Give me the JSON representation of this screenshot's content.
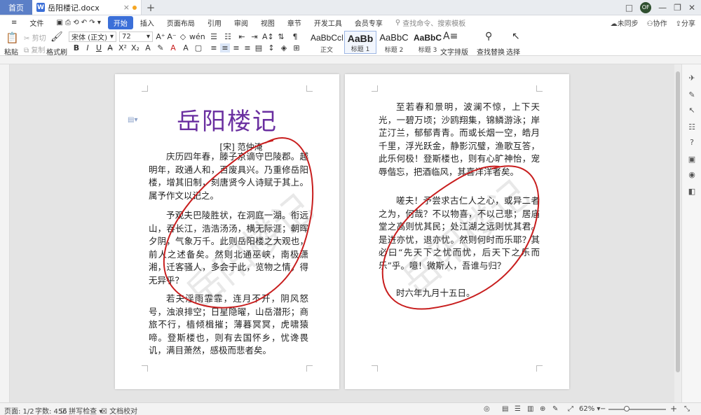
{
  "titlebar": {
    "home_tab": "首页",
    "doc_tab": "岳阳楼记.docx",
    "doc_icon_letter": "W",
    "new_tab": "+",
    "window_buttons": [
      "□",
      "—",
      "❐",
      "✕"
    ],
    "avatar_text": "OF"
  },
  "ribbon": {
    "file_menu": "文件",
    "tabs": [
      "开始",
      "插入",
      "页面布局",
      "引用",
      "审阅",
      "视图",
      "章节",
      "开发工具",
      "会员专享"
    ],
    "search_placeholder": "查找命令、搜索模板",
    "sync": "未同步",
    "collab": "协作",
    "share": "分享"
  },
  "toolbar": {
    "paste": "粘贴",
    "cut": "剪切",
    "copy": "复制",
    "format_painter": "格式刷",
    "font_name": "宋体 (正文)",
    "font_size": "72",
    "styles": [
      {
        "sample": "AaBbCcI",
        "label": "正文"
      },
      {
        "sample": "AaBb",
        "label": "标题 1"
      },
      {
        "sample": "AaBbC",
        "label": "标题 2"
      },
      {
        "sample": "AaBbC",
        "label": "标题 3"
      }
    ],
    "text_layout": "文字排版",
    "find_replace": "查找替换",
    "select": "选择"
  },
  "document": {
    "title": "岳阳楼记",
    "author": "[宋] 范仲淹",
    "page1_paragraphs": [
      "庆历四年春，滕子京谪守巴陵郡。越明年，政通人和，百废具兴。乃重修岳阳楼，增其旧制，刻唐贤今人诗赋于其上。属予作文以记之。",
      "予观夫巴陵胜状，在洞庭一湖。衔远山，吞长江，浩浩汤汤，横无际涯；朝晖夕阴，气象万千。此则岳阳楼之大观也，前人之述备矣。然则北通巫峡，南极潇湘，迁客骚人，多会于此，览物之情，得无异乎？",
      "若夫淫雨霏霏，连月不开，阴风怒号，浊浪排空；日星隐曜，山岳潜形；商旅不行，樯倾楫摧；薄暮冥冥，虎啸猿啼。登斯楼也，则有去国怀乡，忧谗畏讥，满目萧然，感极而悲者矣。"
    ],
    "page2_paragraphs": [
      "至若春和景明，波澜不惊，上下天光，一碧万顷；沙鸥翔集，锦鳞游泳；岸芷汀兰，郁郁青青。而或长烟一空，皓月千里，浮光跃金，静影沉璧，渔歌互答，此乐何极！登斯楼也，则有心旷神怡，宠辱偕忘，把酒临风，其喜洋洋者矣。",
      "嗟夫！予尝求古仁人之心，或异二者之为，何哉？不以物喜，不以己悲；居庙堂之高则忧其民；处江湖之远则忧其君。是进亦忧，退亦忧。然则何时而乐耶？其必曰“先天下之忧而忧，后天下之乐而乐”乎。噫！微斯人，吾谁与归？",
      "时六年九月十五日。"
    ],
    "watermark": "岳阳楼记"
  },
  "statusbar": {
    "page": "页面: 1/2",
    "word_count": "字数: 456",
    "spell_check": "拼写检查",
    "proofread": "文档校对",
    "zoom": "62%",
    "zoom_minus": "−",
    "zoom_plus": "+"
  },
  "colors": {
    "accent": "#3b6fd8",
    "title_purple": "#6a2fa0",
    "ink_red": "#c81e1e"
  }
}
